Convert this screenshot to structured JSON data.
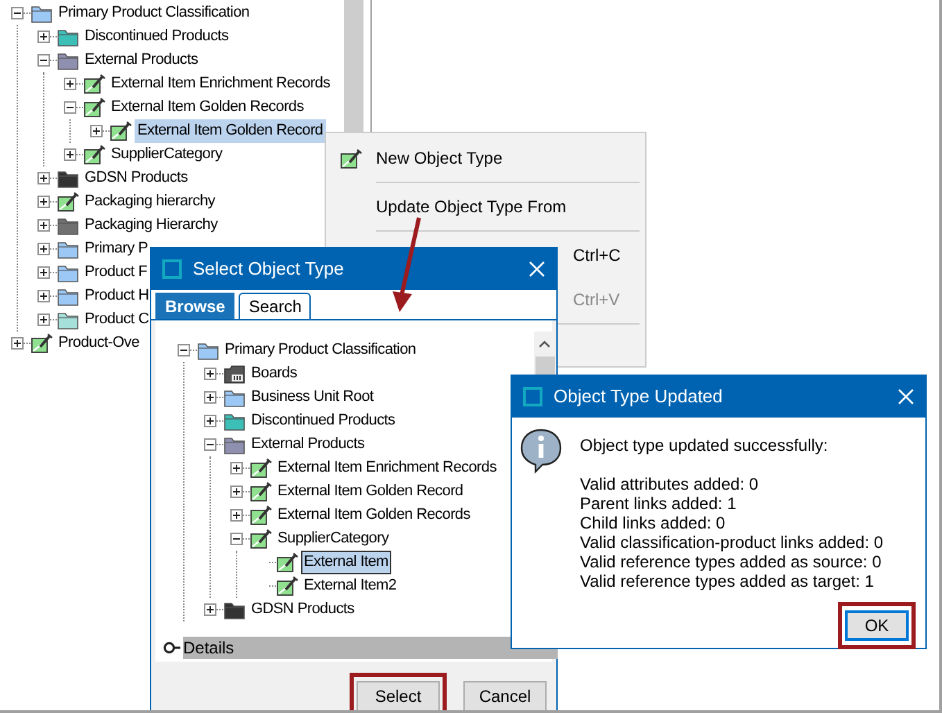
{
  "tree": {
    "nodes": [
      {
        "label": "Primary Product Classification",
        "kind": "folder",
        "color": "#9cc8f5",
        "expanded": true,
        "selected": false,
        "children": [
          {
            "label": "Discontinued Products",
            "kind": "folder",
            "color": "#3bbfb7",
            "expanded": false,
            "selected": false
          },
          {
            "label": "External Products",
            "kind": "folder",
            "color": "#8f8fb0",
            "expanded": true,
            "selected": false,
            "children": [
              {
                "label": "External Item Enrichment Records",
                "kind": "object-type",
                "expanded": false,
                "selected": false
              },
              {
                "label": "External Item Golden Records",
                "kind": "object-type",
                "expanded": true,
                "selected": false,
                "children": [
                  {
                    "label": "External Item Golden Record",
                    "kind": "object-type",
                    "expanded": false,
                    "selected": true
                  }
                ]
              },
              {
                "label": "SupplierCategory",
                "kind": "object-type",
                "expanded": false,
                "selected": false
              }
            ]
          },
          {
            "label": "GDSN Products",
            "kind": "folder",
            "color": "#333333",
            "expanded": false,
            "selected": false
          },
          {
            "label": "Packaging hierarchy",
            "kind": "object-type",
            "expanded": false,
            "selected": false
          },
          {
            "label": "Packaging Hierarchy",
            "kind": "folder",
            "color": "#707070",
            "expanded": false,
            "selected": false
          },
          {
            "label": "Primary P",
            "kind": "folder",
            "color": "#9cc8f5",
            "expanded": false,
            "selected": false
          },
          {
            "label": "Product F",
            "kind": "folder",
            "color": "#9cc8f5",
            "expanded": false,
            "selected": false
          },
          {
            "label": "Product H",
            "kind": "folder",
            "color": "#9cc8f5",
            "expanded": false,
            "selected": false
          },
          {
            "label": "Product C",
            "kind": "folder",
            "color": "#a6e0da",
            "expanded": false,
            "selected": false
          }
        ]
      },
      {
        "label": "Product-Ove",
        "kind": "object-type",
        "expanded": false,
        "selected": false
      }
    ]
  },
  "context_menu": {
    "items": [
      {
        "kind": "item",
        "label": "New Object Type",
        "disabled": false
      },
      {
        "kind": "separator"
      },
      {
        "kind": "item",
        "label": "Update Object Type From",
        "disabled": false
      },
      {
        "kind": "separator"
      },
      {
        "kind": "item",
        "shortcut": "Ctrl+C",
        "disabled": false
      },
      {
        "kind": "item",
        "shortcut": "Ctrl+V",
        "disabled": true
      },
      {
        "kind": "separator"
      }
    ]
  },
  "select_dialog": {
    "title": "Select Object Type",
    "tabs": [
      {
        "label": "Browse",
        "selected": true
      },
      {
        "label": "Search",
        "selected": false
      }
    ],
    "tree": {
      "nodes": [
        {
          "label": "Primary Product Classification",
          "kind": "folder",
          "color": "#9cc8f5",
          "expanded": true,
          "selected": false,
          "children": [
            {
              "label": "Boards",
              "kind": "boards",
              "expanded": false,
              "selected": false
            },
            {
              "label": "Business Unit Root",
              "kind": "folder",
              "color": "#9cc8f5",
              "expanded": false,
              "selected": false
            },
            {
              "label": "Discontinued Products",
              "kind": "folder",
              "color": "#3bbfb7",
              "expanded": false,
              "selected": false
            },
            {
              "label": "External Products",
              "kind": "folder",
              "color": "#8f8fb0",
              "expanded": true,
              "selected": false,
              "children": [
                {
                  "label": "External Item Enrichment Records",
                  "kind": "object-type",
                  "expanded": false,
                  "selected": false
                },
                {
                  "label": "External Item Golden Record",
                  "kind": "object-type",
                  "expanded": false,
                  "selected": false
                },
                {
                  "label": "External Item Golden Records",
                  "kind": "object-type",
                  "expanded": false,
                  "selected": false
                },
                {
                  "label": "SupplierCategory",
                  "kind": "object-type",
                  "expanded": true,
                  "selected": false,
                  "children": [
                    {
                      "label": "External Item",
                      "kind": "object-type",
                      "selected": true
                    },
                    {
                      "label": "External Item2",
                      "kind": "object-type",
                      "selected": false
                    }
                  ]
                }
              ]
            },
            {
              "label": "GDSN Products",
              "kind": "folder",
              "color": "#333333",
              "expanded": false,
              "selected": false
            }
          ]
        }
      ]
    },
    "details_label": "Details",
    "buttons": [
      {
        "label": "Select",
        "highlighted": true,
        "focused": false
      },
      {
        "label": "Cancel",
        "highlighted": false,
        "focused": false
      }
    ]
  },
  "info_dialog": {
    "title": "Object Type Updated",
    "message": "Object type updated successfully:",
    "details": [
      "Valid attributes added: 0",
      "Parent links added: 1",
      "Child links added: 0",
      "Valid classification-product links added: 0",
      "Valid reference types added as source: 0",
      "Valid reference types added as target: 1"
    ],
    "buttons": [
      {
        "label": "OK",
        "highlighted": true,
        "focused": true
      }
    ]
  }
}
